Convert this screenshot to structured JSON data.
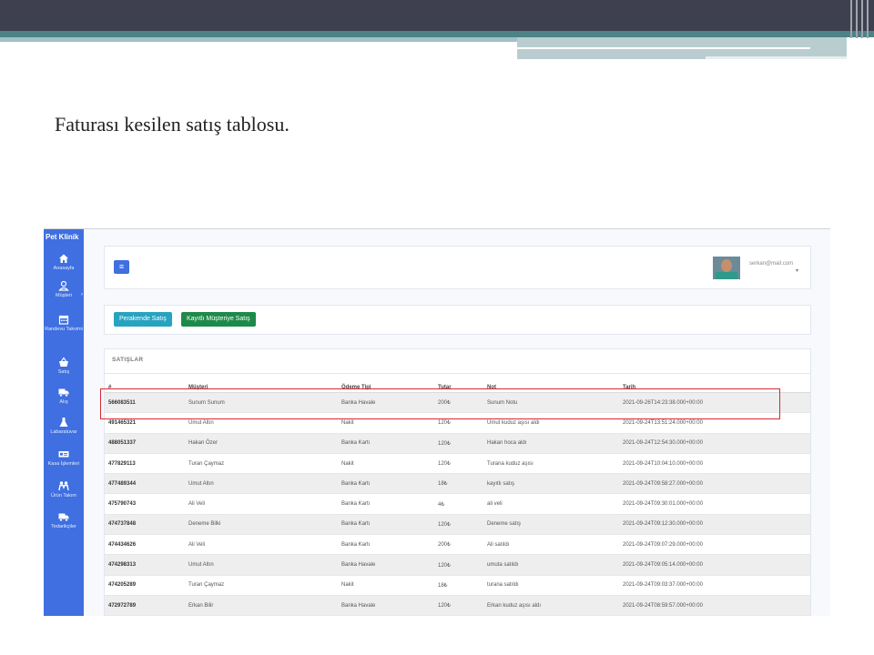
{
  "slide": {
    "caption": "Faturası kesilen satış tablosu."
  },
  "app": {
    "brand": "Pet Klinik",
    "nav": [
      {
        "label": "Anasayfa",
        "icon": "home-icon"
      },
      {
        "label": "Müşteri",
        "icon": "user-icon"
      },
      {
        "label": "Randevu Takvimi",
        "icon": "calendar-icon"
      },
      {
        "label": "Satış",
        "icon": "basket-icon"
      },
      {
        "label": "Alış",
        "icon": "truck-icon"
      },
      {
        "label": "Labaratuvar",
        "icon": "flask-icon"
      },
      {
        "label": "Kasa İşlemleri",
        "icon": "cash-icon"
      },
      {
        "label": "Ürün Takım",
        "icon": "people-icon"
      },
      {
        "label": "Tedarikçiler",
        "icon": "truck-icon"
      }
    ],
    "header": {
      "menu_icon": "bars-icon",
      "user_email": "serkan@mail.com"
    },
    "buttons": {
      "retail": "Perakende Satış",
      "registered": "Kayıtlı Müşteriye Satış"
    },
    "sales_table": {
      "title": "SATIŞLAR",
      "columns": [
        "#",
        "Müşteri",
        "Ödeme Tipi",
        "Tutar",
        "Not",
        "Tarih"
      ],
      "rows": [
        [
          "566083511",
          "Sunum Sunum",
          "Banka Havale",
          "200₺",
          "Sunum Notu",
          "2021-09-26T14:23:38.000+00:00"
        ],
        [
          "491465321",
          "Umut Altın",
          "Nakit",
          "120₺",
          "Umut kuduz aşısı aldı",
          "2021-09-24T13:51:24.000+00:00"
        ],
        [
          "488051337",
          "Hakan Özer",
          "Banka Kartı",
          "120₺",
          "Hakan hoca aldı",
          "2021-09-24T12:54:30.000+00:00"
        ],
        [
          "477829113",
          "Turan Çaymaz",
          "Nakit",
          "120₺",
          "Turana kuduz aşısı",
          "2021-09-24T10:04:10.000+00:00"
        ],
        [
          "477489344",
          "Umut Altın",
          "Banka Kartı",
          "18₺",
          "kayıtlı satış",
          "2021-09-24T09:58:27.000+00:00"
        ],
        [
          "475790743",
          "Ali Veli",
          "Banka Kartı",
          "4₺",
          "ali veli",
          "2021-09-24T09:30:01.000+00:00"
        ],
        [
          "474737848",
          "Deneme Bilki",
          "Banka Kartı",
          "120₺",
          "Deneme satış",
          "2021-09-24T09:12:30.000+00:00"
        ],
        [
          "474434626",
          "Ali Veli",
          "Banka Kartı",
          "200₺",
          "Ali satıldı",
          "2021-09-24T09:07:29.000+00:00"
        ],
        [
          "474298313",
          "Umut Altın",
          "Banka Havale",
          "120₺",
          "umuta satıldı",
          "2021-09-24T09:05:14.000+00:00"
        ],
        [
          "474205289",
          "Turan Çaymaz",
          "Nakit",
          "18₺",
          "turana satıldı",
          "2021-09-24T09:03:37.000+00:00"
        ],
        [
          "472972789",
          "Erkan Bilir",
          "Banka Havale",
          "120₺",
          "Erkan kuduz aşısı aldı",
          "2021-09-24T08:59:57.000+00:00"
        ]
      ]
    }
  },
  "colors": {
    "sidebar": "#3f6fe0",
    "highlight": "#d9282f",
    "retail_button": "#27a3c0",
    "registered_button": "#1e8a4a"
  }
}
